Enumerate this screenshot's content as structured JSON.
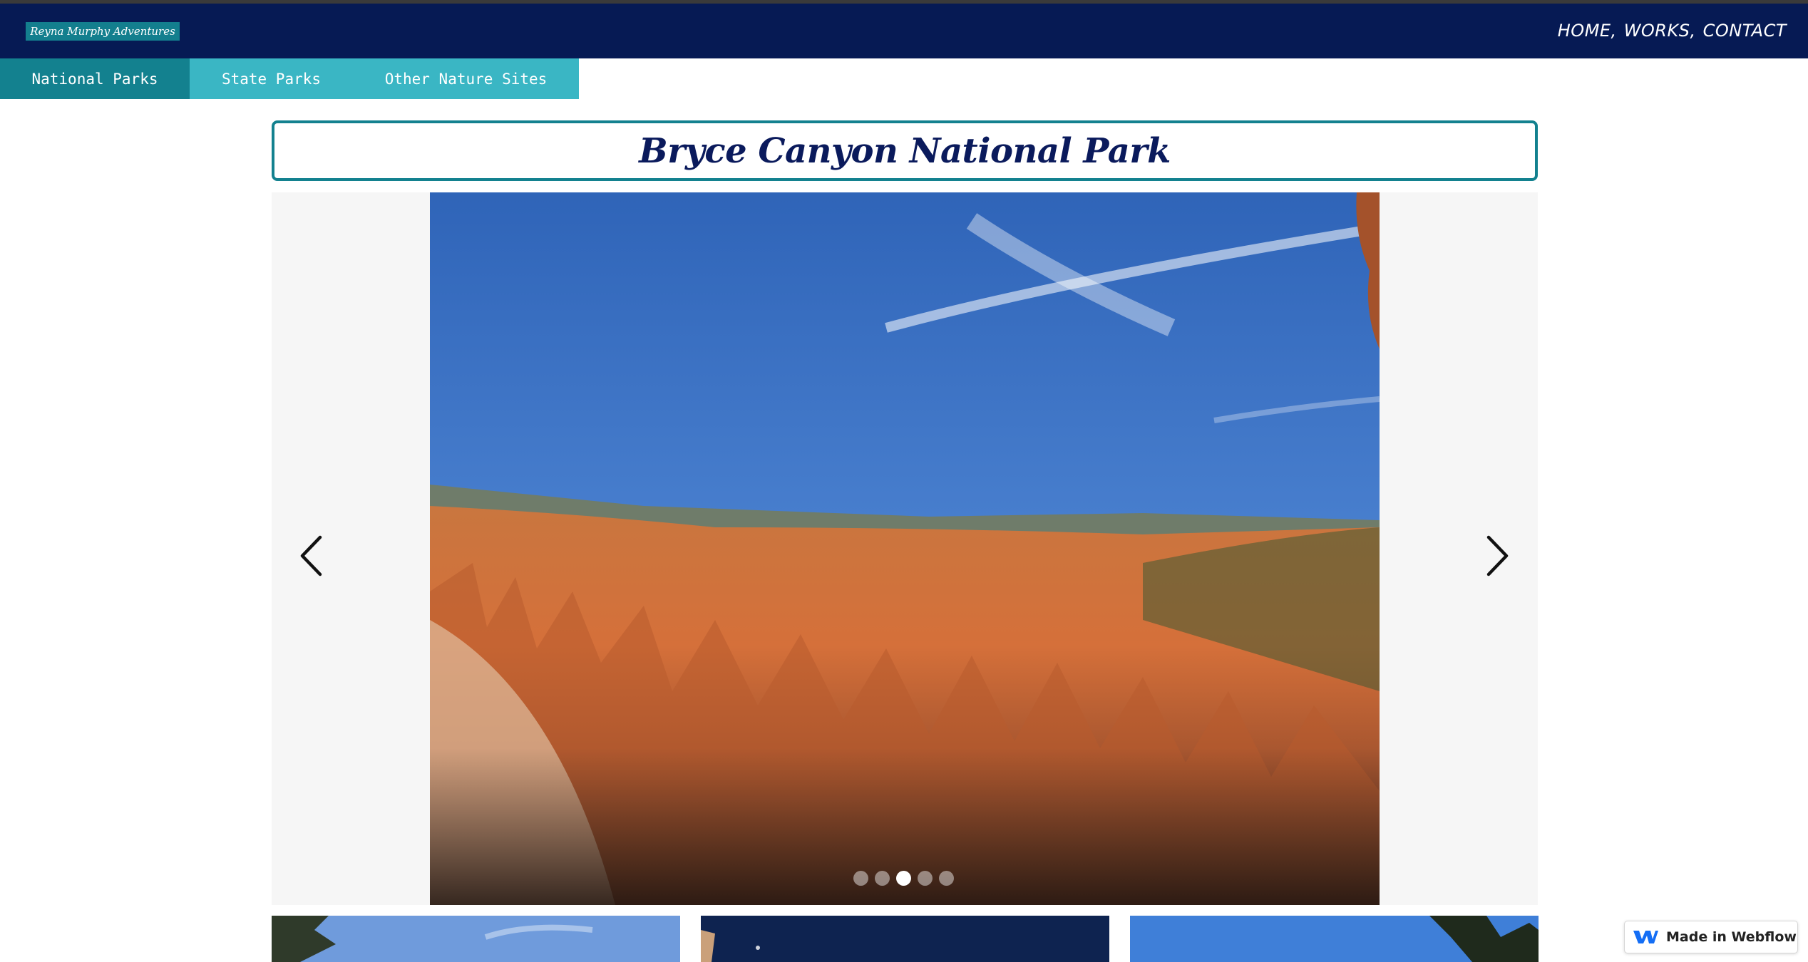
{
  "brand": {
    "name": "Reyna Murphy Adventures"
  },
  "nav": {
    "home": "HOME,",
    "works": "WORKS,",
    "contact": "CONTACT"
  },
  "tabs": [
    {
      "label": "National Parks",
      "active": true
    },
    {
      "label": "State Parks",
      "active": false
    },
    {
      "label": "Other Nature Sites",
      "active": false
    }
  ],
  "page": {
    "title": "Bryce Canyon National Park"
  },
  "slider": {
    "slide_count": 5,
    "active_index": 2
  },
  "badge": {
    "label": "Made in Webflow"
  },
  "colors": {
    "navbar": "#061a54",
    "brand_bg": "#137f8e",
    "tab_active": "#13818f",
    "tab_inactive": "#3ab6c4",
    "title_text": "#0a1a5c"
  },
  "icons": [
    "chevron-left-icon",
    "chevron-right-icon",
    "webflow-logo-icon"
  ]
}
